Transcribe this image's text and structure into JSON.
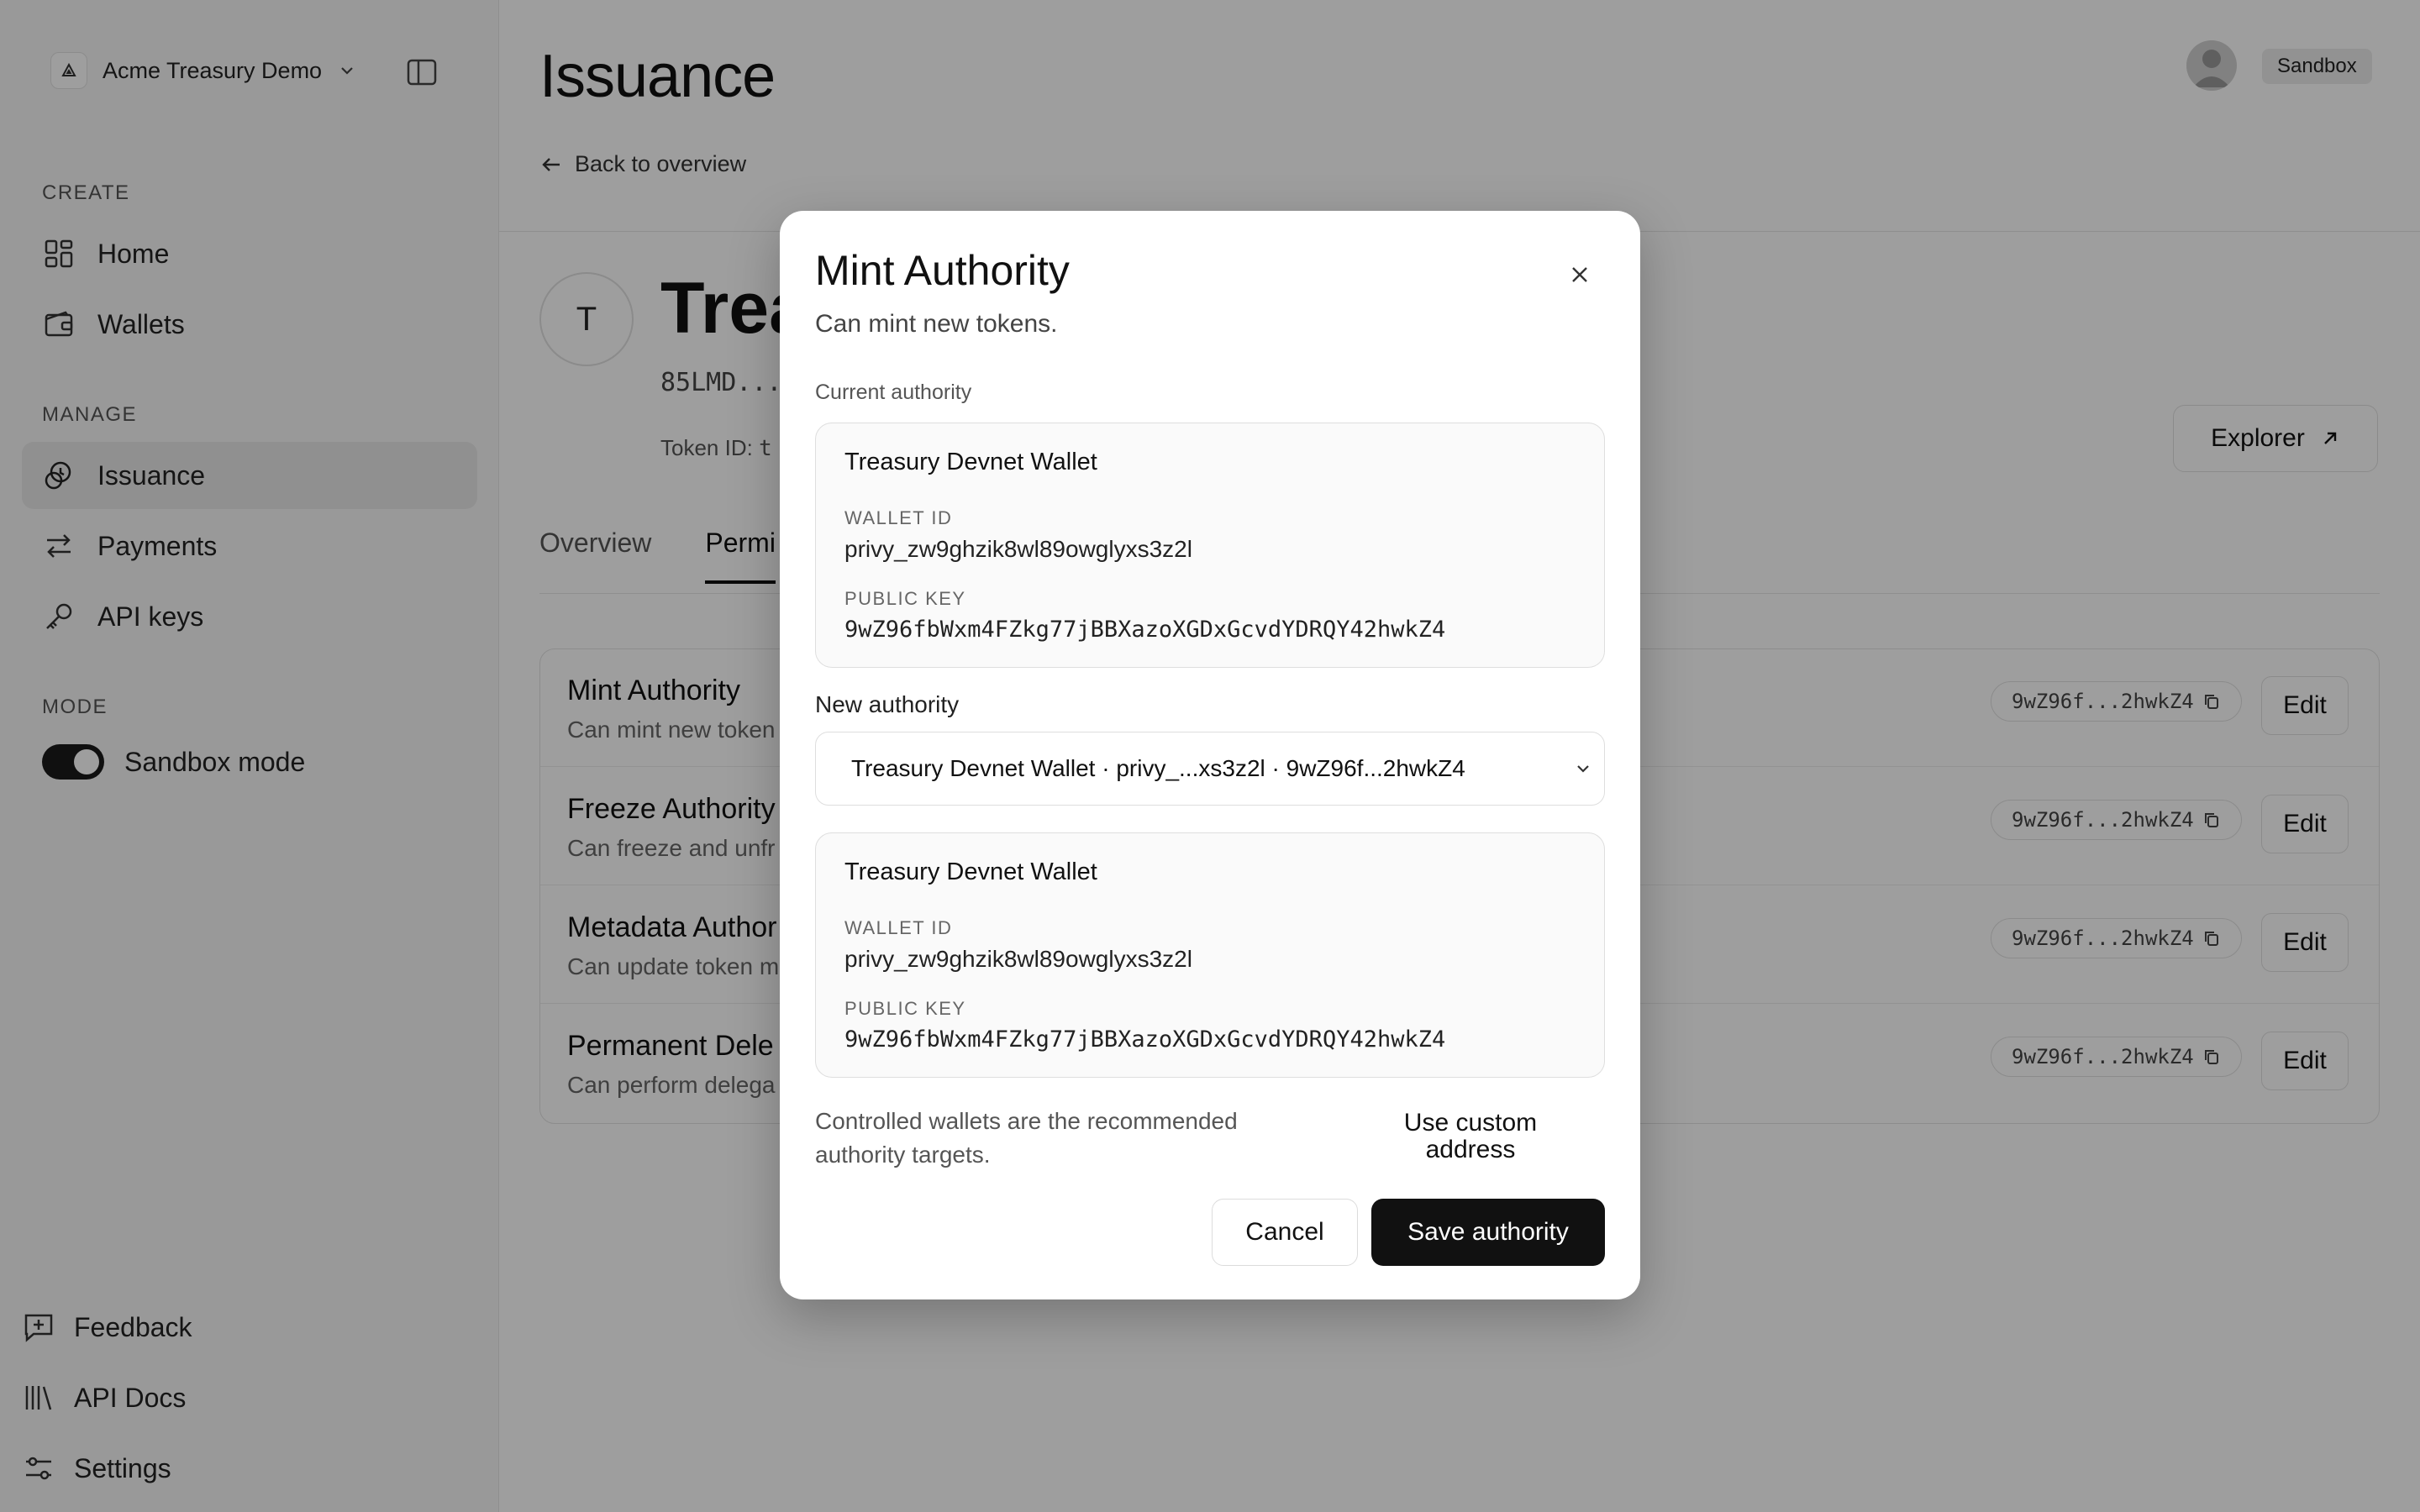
{
  "sidebar": {
    "workspace_name": "Acme Treasury Demo",
    "sections": {
      "create": "CREATE",
      "manage": "MANAGE",
      "mode": "MODE"
    },
    "items": {
      "home": "Home",
      "wallets": "Wallets",
      "issuance": "Issuance",
      "payments": "Payments",
      "api_keys": "API keys"
    },
    "mode_label": "Sandbox mode",
    "bottom": {
      "feedback": "Feedback",
      "api_docs": "API Docs",
      "settings": "Settings"
    }
  },
  "header": {
    "title": "Issuance",
    "back_label": "Back to overview",
    "env_badge": "Sandbox"
  },
  "token": {
    "avatar_letter": "T",
    "name_visible": "Trea",
    "address_visible": "85LMD...",
    "token_id_label": "Token ID:",
    "token_id_visible": "t",
    "explorer_label": "Explorer"
  },
  "tabs": {
    "overview": "Overview",
    "permissions_visible": "Permi"
  },
  "permissions": [
    {
      "title": "Mint Authority",
      "desc": "Can mint new token",
      "chip": "9wZ96f...2hwkZ4",
      "edit": "Edit"
    },
    {
      "title": "Freeze Authority",
      "desc": "Can freeze and unfr",
      "chip": "9wZ96f...2hwkZ4",
      "edit": "Edit"
    },
    {
      "title": "Metadata Author",
      "desc": "Can update token m",
      "chip": "9wZ96f...2hwkZ4",
      "edit": "Edit"
    },
    {
      "title": "Permanent Dele",
      "desc": "Can perform delega",
      "chip": "9wZ96f...2hwkZ4",
      "edit": "Edit"
    }
  ],
  "modal": {
    "title": "Mint Authority",
    "subtitle": "Can mint new tokens.",
    "current_label": "Current authority",
    "current": {
      "name": "Treasury Devnet Wallet",
      "wallet_id_label": "WALLET ID",
      "wallet_id": "privy_zw9ghzik8wl89owglyxs3z2l",
      "public_key_label": "PUBLIC KEY",
      "public_key": "9wZ96fbWxm4FZkg77jBBXazoXGDxGcvdYDRQY42hwkZ4"
    },
    "new_label": "New authority",
    "select_value": "Treasury Devnet Wallet · privy_...xs3z2l · 9wZ96f...2hwkZ4",
    "selected": {
      "name": "Treasury Devnet Wallet",
      "wallet_id_label": "WALLET ID",
      "wallet_id": "privy_zw9ghzik8wl89owglyxs3z2l",
      "public_key_label": "PUBLIC KEY",
      "public_key": "9wZ96fbWxm4FZkg77jBBXazoXGDxGcvdYDRQY42hwkZ4"
    },
    "note": "Controlled wallets are the recommended authority targets.",
    "custom_address": "Use custom address",
    "cancel": "Cancel",
    "save": "Save authority"
  }
}
